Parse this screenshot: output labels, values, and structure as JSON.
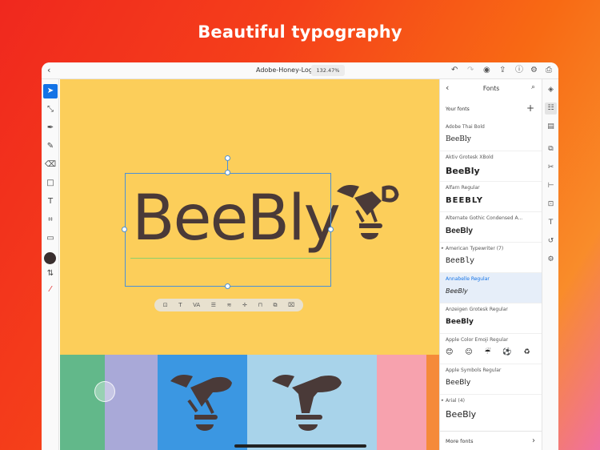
{
  "headline": "Beautiful typography",
  "topbar": {
    "doc_name": "Adobe-Honey-Logo",
    "zoom": "132.47%",
    "back_icon": "chevron-left-icon",
    "right_icons": [
      "undo-icon",
      "redo-icon",
      "collaborate-icon",
      "share-icon",
      "help-icon",
      "settings-icon",
      "export-icon"
    ]
  },
  "canvas": {
    "logo_text": "BeeBly",
    "background": "#fcce5a",
    "ink": "#4a3a38",
    "context_toolbar_icons": [
      "text-frame-icon",
      "type-size-icon",
      "tracking-icon",
      "list-icon",
      "spacing-icon",
      "align-icon",
      "lock-icon",
      "group-icon",
      "trash-icon"
    ],
    "swatches": [
      "#62b88a",
      "#a9a9d8",
      "#3b97e2",
      "#a8d3ea",
      "#f7a2ae",
      "#f58a3a"
    ]
  },
  "panel": {
    "title": "Fonts",
    "section_label": "Your fonts",
    "fonts": [
      {
        "name": "Adobe Thai Bold",
        "sample": "BeeBly"
      },
      {
        "name": "Aktiv Grotesk XBold",
        "sample": "BeeBly"
      },
      {
        "name": "Alfarn Regular",
        "sample": "BEEBLY"
      },
      {
        "name": "Alternate Gothic Condensed A...",
        "sample": "BeeBly"
      },
      {
        "name": "American Typewriter (7)",
        "sample": "BeeBly"
      },
      {
        "name": "Annabelle Regular",
        "sample": "BeeBly"
      },
      {
        "name": "Anzeigen Grotesk Regular",
        "sample": "BeeBly"
      },
      {
        "name": "Apple Color Emoji Regular",
        "sample": "😊 😐 ☔ ⚽ ♻"
      },
      {
        "name": "Apple Symbols Regular",
        "sample": "BeeBly"
      },
      {
        "name": "Arial (4)",
        "sample": "BeeBly"
      }
    ],
    "more_fonts": "More fonts"
  },
  "colors": {
    "accent": "#1473e6",
    "selected_row": "#e6eef9"
  }
}
